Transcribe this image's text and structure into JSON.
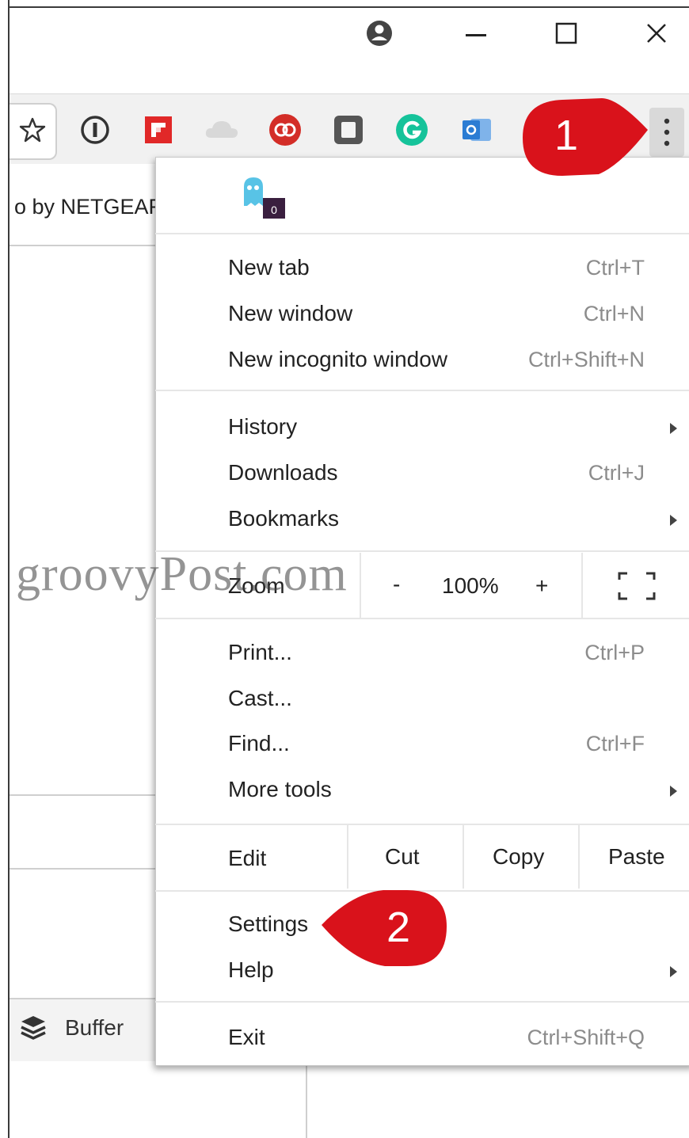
{
  "window": {
    "icons": {
      "profile": "profile-icon",
      "minimize": "minimize-icon",
      "maximize": "maximize-icon",
      "close": "close-icon"
    }
  },
  "toolbar": {
    "extensions": [
      "star-icon",
      "1password-icon",
      "flipboard-icon",
      "cloud-icon",
      "lastpass-icon",
      "evernote-icon",
      "grammarly-icon",
      "outlook-icon"
    ],
    "menu_icon": "three-dot-menu-icon"
  },
  "page": {
    "tab_text": "o by NETGEAR",
    "buffer_label": "Buffer",
    "watermark": "groovyPost.com"
  },
  "menu": {
    "new_tab": {
      "label": "New tab",
      "shortcut": "Ctrl+T"
    },
    "new_window": {
      "label": "New window",
      "shortcut": "Ctrl+N"
    },
    "new_incognito": {
      "label": "New incognito window",
      "shortcut": "Ctrl+Shift+N"
    },
    "history": {
      "label": "History"
    },
    "downloads": {
      "label": "Downloads",
      "shortcut": "Ctrl+J"
    },
    "bookmarks": {
      "label": "Bookmarks"
    },
    "zoom": {
      "label": "Zoom",
      "minus": "-",
      "value": "100%",
      "plus": "+"
    },
    "print": {
      "label": "Print...",
      "shortcut": "Ctrl+P"
    },
    "cast": {
      "label": "Cast..."
    },
    "find": {
      "label": "Find...",
      "shortcut": "Ctrl+F"
    },
    "more_tools": {
      "label": "More tools"
    },
    "edit": {
      "label": "Edit",
      "cut": "Cut",
      "copy": "Copy",
      "paste": "Paste"
    },
    "settings": {
      "label": "Settings"
    },
    "help": {
      "label": "Help"
    },
    "exit": {
      "label": "Exit",
      "shortcut": "Ctrl+Shift+Q"
    }
  },
  "callouts": {
    "one": "1",
    "two": "2"
  },
  "colors": {
    "callout": "#d9121b",
    "menu_button_bg": "#d9d9d9",
    "grammarly": "#15c39a",
    "lastpass": "#d32d27"
  }
}
